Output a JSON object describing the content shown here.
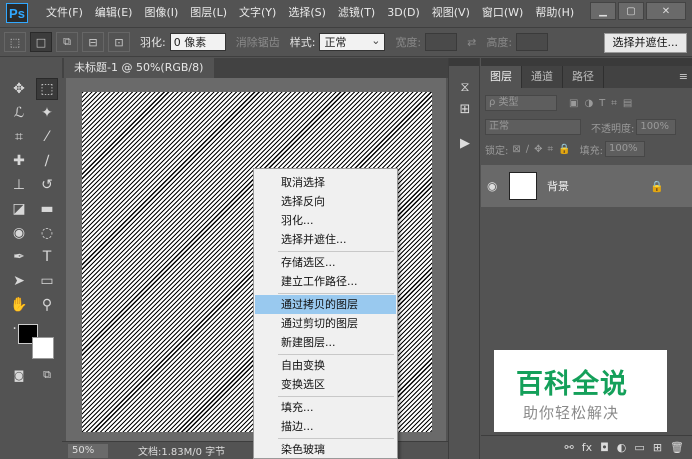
{
  "app": {
    "logo": "Ps"
  },
  "menubar": {
    "items": [
      "文件(F)",
      "编辑(E)",
      "图像(I)",
      "图层(L)",
      "文字(Y)",
      "选择(S)",
      "滤镜(T)",
      "3D(D)",
      "视图(V)",
      "窗口(W)",
      "帮助(H)"
    ],
    "minimize": "▁",
    "maximize": "▢",
    "close": "✕"
  },
  "options": {
    "feather_label": "羽化:",
    "feather_value": "0 像素",
    "antialias_label": "消除锯齿",
    "style_label": "样式:",
    "style_value": "正常",
    "width_label": "宽度:",
    "height_label": "高度:",
    "select_mask_button": "选择并遮住..."
  },
  "document": {
    "tab_title": "未标题-1 @ 50%(RGB/8) *",
    "tab_close": "×",
    "zoom": "50%",
    "doc_info": "文档:1.83M/0 字节"
  },
  "context_menu": {
    "items": [
      "取消选择",
      "选择反向",
      "羽化...",
      "选择并遮住...",
      "存储选区...",
      "建立工作路径...",
      "通过拷贝的图层",
      "通过剪切的图层",
      "新建图层...",
      "自由变换",
      "变换选区",
      "填充...",
      "描边...",
      "染色玻璃"
    ],
    "highlighted_index": 6
  },
  "layers_panel": {
    "tabs": [
      "图层",
      "通道",
      "路径"
    ],
    "filter_label": "ρ 类型",
    "blend_mode": "正常",
    "opacity_label": "不透明度:",
    "opacity_value": "100%",
    "lock_label": "锁定:",
    "fill_label": "填充:",
    "fill_value": "100%",
    "layer_name": "背景"
  },
  "watermark": {
    "title": "百科全说",
    "subtitle": "助你轻松解决"
  },
  "colors": {
    "ui_bg": "#535353",
    "highlight": "#99c9ef",
    "watermark_green": "#14a05a"
  }
}
